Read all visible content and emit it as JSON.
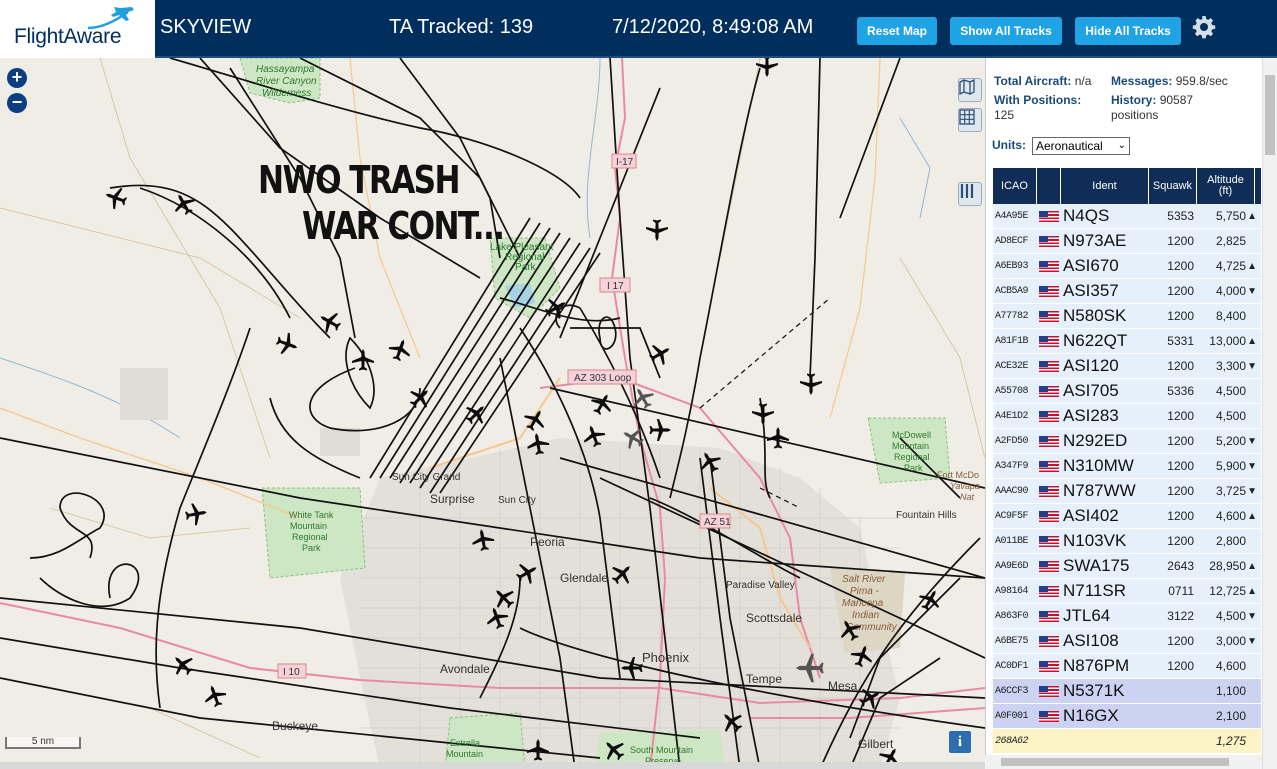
{
  "header": {
    "logo_text": "FlightAware",
    "site_name": "SKYVIEW",
    "tracked_label": "TA Tracked: 139",
    "clock": "7/12/2020, 8:49:08 AM",
    "buttons": {
      "reset": "Reset Map",
      "show_all": "Show All Tracks",
      "hide_all": "Hide All Tracks"
    },
    "colors": {
      "bar": "#002f5d",
      "button": "#1fa3e4"
    }
  },
  "map": {
    "overlay_line1": "NWO TRASH",
    "overlay_line2": "WAR CONT...",
    "scale_label": "5 nm",
    "labels": {
      "hassayampa": "Hassayampa\nRiver Canyon\nWilderness",
      "lake_pleasant": "Lake Pleasant\nRegional\nPark",
      "i17_a": "I-17",
      "i17_b": "I 17",
      "az303": "AZ 303 Loop",
      "mcdowell": "McDowell\nMountain\nRegional\nPark",
      "fort_mcdowell": "Fort McDo\nYavapa\nNat",
      "sun_city_grand": "Sun City Grand",
      "surprise": "Surprise",
      "sun_city": "Sun City",
      "white_tank": "White Tank\nMountain\nRegional\nPark",
      "fountain_hills": "Fountain Hills",
      "peoria": "Peoria",
      "az51": "AZ 51",
      "glendale": "Glendale",
      "paradise_valley": "Paradise Valley",
      "salt_river": "Salt River\nPima -\nMaricopa\nIndian\nCommunity",
      "scottsdale": "Scottsdale",
      "i10": "I 10",
      "avondale": "Avondale",
      "phoenix": "Phoenix",
      "tempe": "Tempe",
      "mesa": "Mesa",
      "buckeye": "Buckeye",
      "estrella": "Estrella\nMountain",
      "south_mountain": "South Mountain\nPreserve",
      "gilbert": "Gilbert"
    },
    "icons": [
      "zoom-in-icon",
      "zoom-out-icon",
      "map-layers-icon",
      "grid-icon",
      "column-toggle-icon",
      "info-icon"
    ]
  },
  "sidebar": {
    "stats": {
      "total_aircraft_label": "Total Aircraft:",
      "total_aircraft_value": "n/a",
      "messages_label": "Messages:",
      "messages_value": "959.8/sec",
      "with_positions_label": "With Positions:",
      "with_positions_value": "125",
      "history_label": "History:",
      "history_value": "90587",
      "history_unit": "positions"
    },
    "units_label": "Units:",
    "units_value": "Aeronautical",
    "table": {
      "headers": [
        "ICAO",
        "Ident",
        "Squawk",
        "Altitude (ft)"
      ],
      "rows": [
        {
          "icao": "A4A95E",
          "ident": "N4QS",
          "squawk": "5353",
          "alt": "5,750",
          "trend": "▲",
          "bg": "#e6f0fb"
        },
        {
          "icao": "AD8ECF",
          "ident": "N973AE",
          "squawk": "1200",
          "alt": "2,825",
          "trend": "",
          "bg": "#e6f0fb"
        },
        {
          "icao": "A6EB93",
          "ident": "ASI670",
          "squawk": "1200",
          "alt": "4,725",
          "trend": "▲",
          "bg": "#e6f0fb"
        },
        {
          "icao": "ACB5A9",
          "ident": "ASI357",
          "squawk": "1200",
          "alt": "4,000",
          "trend": "▼",
          "bg": "#e6f0fb"
        },
        {
          "icao": "A77782",
          "ident": "N580SK",
          "squawk": "1200",
          "alt": "8,400",
          "trend": "",
          "bg": "#e6f0fb"
        },
        {
          "icao": "A81F1B",
          "ident": "N622QT",
          "squawk": "5331",
          "alt": "13,000",
          "trend": "▲",
          "bg": "#e6f0fb"
        },
        {
          "icao": "ACE32E",
          "ident": "ASI120",
          "squawk": "1200",
          "alt": "3,300",
          "trend": "▼",
          "bg": "#e6f0fb"
        },
        {
          "icao": "A55708",
          "ident": "ASI705",
          "squawk": "5336",
          "alt": "4,500",
          "trend": "",
          "bg": "#e6f0fb"
        },
        {
          "icao": "A4E1D2",
          "ident": "ASI283",
          "squawk": "1200",
          "alt": "4,500",
          "trend": "",
          "bg": "#e6f0fb"
        },
        {
          "icao": "A2FD50",
          "ident": "N292ED",
          "squawk": "1200",
          "alt": "5,200",
          "trend": "▼",
          "bg": "#e6f0fb"
        },
        {
          "icao": "A347F9",
          "ident": "N310MW",
          "squawk": "1200",
          "alt": "5,900",
          "trend": "▼",
          "bg": "#e6f0fb"
        },
        {
          "icao": "AAAC90",
          "ident": "N787WW",
          "squawk": "1200",
          "alt": "3,725",
          "trend": "▼",
          "bg": "#e6f0fb"
        },
        {
          "icao": "AC9F5F",
          "ident": "ASI402",
          "squawk": "1200",
          "alt": "4,600",
          "trend": "▲",
          "bg": "#e6f0fb"
        },
        {
          "icao": "A011BE",
          "ident": "N103VK",
          "squawk": "1200",
          "alt": "2,800",
          "trend": "",
          "bg": "#e6f0fb"
        },
        {
          "icao": "AA9E6D",
          "ident": "SWA175",
          "squawk": "2643",
          "alt": "28,950",
          "trend": "▲",
          "bg": "#e6f0fb"
        },
        {
          "icao": "A98164",
          "ident": "N711SR",
          "squawk": "0711",
          "alt": "12,725",
          "trend": "▲",
          "bg": "#e6f0fb"
        },
        {
          "icao": "A863F0",
          "ident": "JTL64",
          "squawk": "3122",
          "alt": "4,500",
          "trend": "▼",
          "bg": "#e6f0fb"
        },
        {
          "icao": "A6BE75",
          "ident": "ASI108",
          "squawk": "1200",
          "alt": "3,000",
          "trend": "▼",
          "bg": "#e6f0fb"
        },
        {
          "icao": "AC0DF1",
          "ident": "N876PM",
          "squawk": "1200",
          "alt": "4,600",
          "trend": "",
          "bg": "#e6f0fb"
        },
        {
          "icao": "A6CCF3",
          "ident": "N5371K",
          "squawk": "",
          "alt": "1,100",
          "trend": "",
          "bg": "#ccd3f2"
        },
        {
          "icao": "A0F001",
          "ident": "N16GX",
          "squawk": "",
          "alt": "2,100",
          "trend": "",
          "bg": "#ccd3f2"
        },
        {
          "icao": "268A62",
          "ident": "",
          "squawk": "",
          "alt": "1,275",
          "trend": "",
          "bg": "#fcf3c6",
          "noflag": true
        }
      ]
    }
  }
}
